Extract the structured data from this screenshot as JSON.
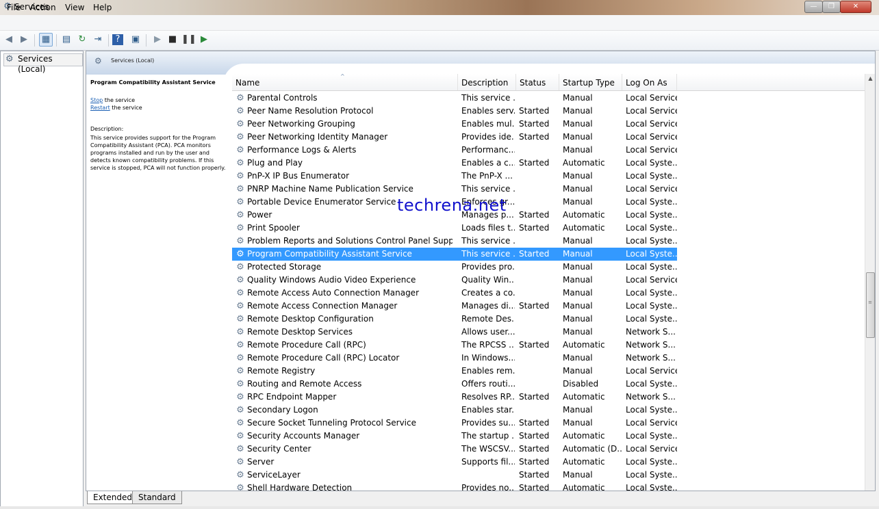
{
  "window": {
    "title": "Services"
  },
  "menu": [
    "File",
    "Action",
    "View",
    "Help"
  ],
  "tree": {
    "root_label": "Services (Local)"
  },
  "panel": {
    "header_title": "Services (Local)",
    "selected_service_name": "Program Compatibility Assistant Service",
    "stop_link": "Stop",
    "stop_suffix": " the service",
    "restart_link": "Restart",
    "restart_suffix": " the service",
    "description_label": "Description:",
    "description_text": "This service provides support for the Program Compatibility Assistant (PCA). PCA monitors programs installed and run by the user and detects known compatibility problems. If this service is stopped, PCA will not function properly."
  },
  "columns": [
    "Name",
    "Description",
    "Status",
    "Startup Type",
    "Log On As"
  ],
  "rows": [
    [
      "Parental Controls",
      "This service ...",
      "",
      "Manual",
      "Local Service"
    ],
    [
      "Peer Name Resolution Protocol",
      "Enables serv...",
      "Started",
      "Manual",
      "Local Service"
    ],
    [
      "Peer Networking Grouping",
      "Enables mul...",
      "Started",
      "Manual",
      "Local Service"
    ],
    [
      "Peer Networking Identity Manager",
      "Provides ide...",
      "Started",
      "Manual",
      "Local Service"
    ],
    [
      "Performance Logs & Alerts",
      "Performanc...",
      "",
      "Manual",
      "Local Service"
    ],
    [
      "Plug and Play",
      "Enables a c...",
      "Started",
      "Automatic",
      "Local Syste..."
    ],
    [
      "PnP-X IP Bus Enumerator",
      "The PnP-X ...",
      "",
      "Manual",
      "Local Syste..."
    ],
    [
      "PNRP Machine Name Publication Service",
      "This service ...",
      "",
      "Manual",
      "Local Service"
    ],
    [
      "Portable Device Enumerator Service",
      "Enforces gr...",
      "",
      "Manual",
      "Local Syste..."
    ],
    [
      "Power",
      "Manages p...",
      "Started",
      "Automatic",
      "Local Syste..."
    ],
    [
      "Print Spooler",
      "Loads files t...",
      "Started",
      "Automatic",
      "Local Syste..."
    ],
    [
      "Problem Reports and Solutions Control Panel Support",
      "This service ...",
      "",
      "Manual",
      "Local Syste..."
    ],
    [
      "Program Compatibility Assistant Service",
      "This service ...",
      "Started",
      "Manual",
      "Local Syste..."
    ],
    [
      "Protected Storage",
      "Provides pro...",
      "",
      "Manual",
      "Local Syste..."
    ],
    [
      "Quality Windows Audio Video Experience",
      "Quality Win...",
      "",
      "Manual",
      "Local Service"
    ],
    [
      "Remote Access Auto Connection Manager",
      "Creates a co...",
      "",
      "Manual",
      "Local Syste..."
    ],
    [
      "Remote Access Connection Manager",
      "Manages di...",
      "Started",
      "Manual",
      "Local Syste..."
    ],
    [
      "Remote Desktop Configuration",
      "Remote Des...",
      "",
      "Manual",
      "Local Syste..."
    ],
    [
      "Remote Desktop Services",
      "Allows user...",
      "",
      "Manual",
      "Network S..."
    ],
    [
      "Remote Procedure Call (RPC)",
      "The RPCSS ...",
      "Started",
      "Automatic",
      "Network S..."
    ],
    [
      "Remote Procedure Call (RPC) Locator",
      "In Windows...",
      "",
      "Manual",
      "Network S..."
    ],
    [
      "Remote Registry",
      "Enables rem...",
      "",
      "Manual",
      "Local Service"
    ],
    [
      "Routing and Remote Access",
      "Offers routi...",
      "",
      "Disabled",
      "Local Syste..."
    ],
    [
      "RPC Endpoint Mapper",
      "Resolves RP...",
      "Started",
      "Automatic",
      "Network S..."
    ],
    [
      "Secondary Logon",
      "Enables star...",
      "",
      "Manual",
      "Local Syste..."
    ],
    [
      "Secure Socket Tunneling Protocol Service",
      "Provides su...",
      "Started",
      "Manual",
      "Local Service"
    ],
    [
      "Security Accounts Manager",
      "The startup ...",
      "Started",
      "Automatic",
      "Local Syste..."
    ],
    [
      "Security Center",
      "The WSCSV...",
      "Started",
      "Automatic (D...",
      "Local Service"
    ],
    [
      "Server",
      "Supports fil...",
      "Started",
      "Automatic",
      "Local Syste..."
    ],
    [
      "ServiceLayer",
      "",
      "Started",
      "Manual",
      "Local Syste..."
    ],
    [
      "Shell Hardware Detection",
      "Provides no...",
      "Started",
      "Automatic",
      "Local Syste..."
    ]
  ],
  "selected_row": 12,
  "watermark": "techrena.net",
  "tabs": [
    "Extended",
    "Standard"
  ],
  "colors": {
    "selection": "#3399ff",
    "link": "#1a5fb4",
    "watermark": "#1111cc"
  }
}
